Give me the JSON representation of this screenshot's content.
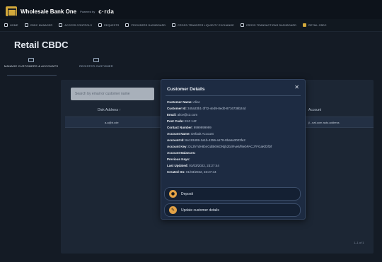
{
  "header": {
    "brand_name": "Wholesale Bank One",
    "powered_by": "Powered by",
    "platform": "c·rda"
  },
  "nav": {
    "items": [
      {
        "label": "HOME",
        "icon": "home-icon"
      },
      {
        "label": "CBDC MANAGER",
        "icon": "grid-icon"
      },
      {
        "label": "ACCESS CONTROLS",
        "icon": "list-icon"
      },
      {
        "label": "REQUESTS",
        "icon": "arrows-icon"
      },
      {
        "label": "PROVIDERS DASHBOARD",
        "icon": "clock-icon"
      },
      {
        "label": "CROSS-TRANSFER LIQUIDITY EXCHANGE",
        "icon": "exchange-icon"
      },
      {
        "label": "CROSS TRANSACTIONS DASHBOARD",
        "icon": "table-icon"
      },
      {
        "label": "RETAIL CBDC",
        "icon": "wallet-icon",
        "active": true
      }
    ]
  },
  "page": {
    "title": "Retail CBDC",
    "tabs": [
      {
        "label": "MANAGE CUSTOMERS & ACCOUNTS",
        "icon": "people-icon",
        "active": true
      },
      {
        "label": "REGISTER CUSTOMER",
        "icon": "person-add-icon",
        "active": false
      }
    ]
  },
  "table": {
    "search_placeholder": "Search by email or customer name",
    "columns": [
      "Disk Address ↑",
      "Account"
    ],
    "row": [
      "a-a@b.cde",
      "jl...nat.com auto.address"
    ],
    "pagination": "1–1 of 1"
  },
  "modal": {
    "title": "Customer Details",
    "close_icon": "close-icon",
    "fields": [
      {
        "label": "Customer Name:",
        "value": "Alice"
      },
      {
        "label": "Customer Id:",
        "value": "345a33b1-3f72-4ed9-8ed0-8716738b24d"
      },
      {
        "label": "Email:",
        "value": "alice@c3.com"
      },
      {
        "label": "Post Code:",
        "value": "E10 1JZ"
      },
      {
        "label": "Contact Number:",
        "value": "9999999999"
      },
      {
        "label": "Account Name:",
        "value": "Default Account"
      },
      {
        "label": "Account Id:",
        "value": "8e193499-1a1b-4356-a178-8ba6a3003fe2"
      },
      {
        "label": "Account Key:",
        "value": "DL3hYdH8bnGdBkh6ONljb2bzRve6/f9ebPACJ7FGaKfDfDf"
      },
      {
        "label": "Account Balances:",
        "value": ""
      },
      {
        "label": "Previous Keys:",
        "value": ""
      },
      {
        "label": "Last Updated:",
        "value": "01/03/2022, 23:27:44"
      },
      {
        "label": "Created On:",
        "value": "01/03/2022, 23:27:44"
      }
    ],
    "actions": [
      {
        "label": "Deposit",
        "icon": "deposit-icon"
      },
      {
        "label": "Update customer details",
        "icon": "pencil-icon"
      }
    ]
  },
  "colors": {
    "accent": "#d3a93b",
    "action_icon": "#e3a246",
    "modal_bg": "#1d2b42"
  }
}
